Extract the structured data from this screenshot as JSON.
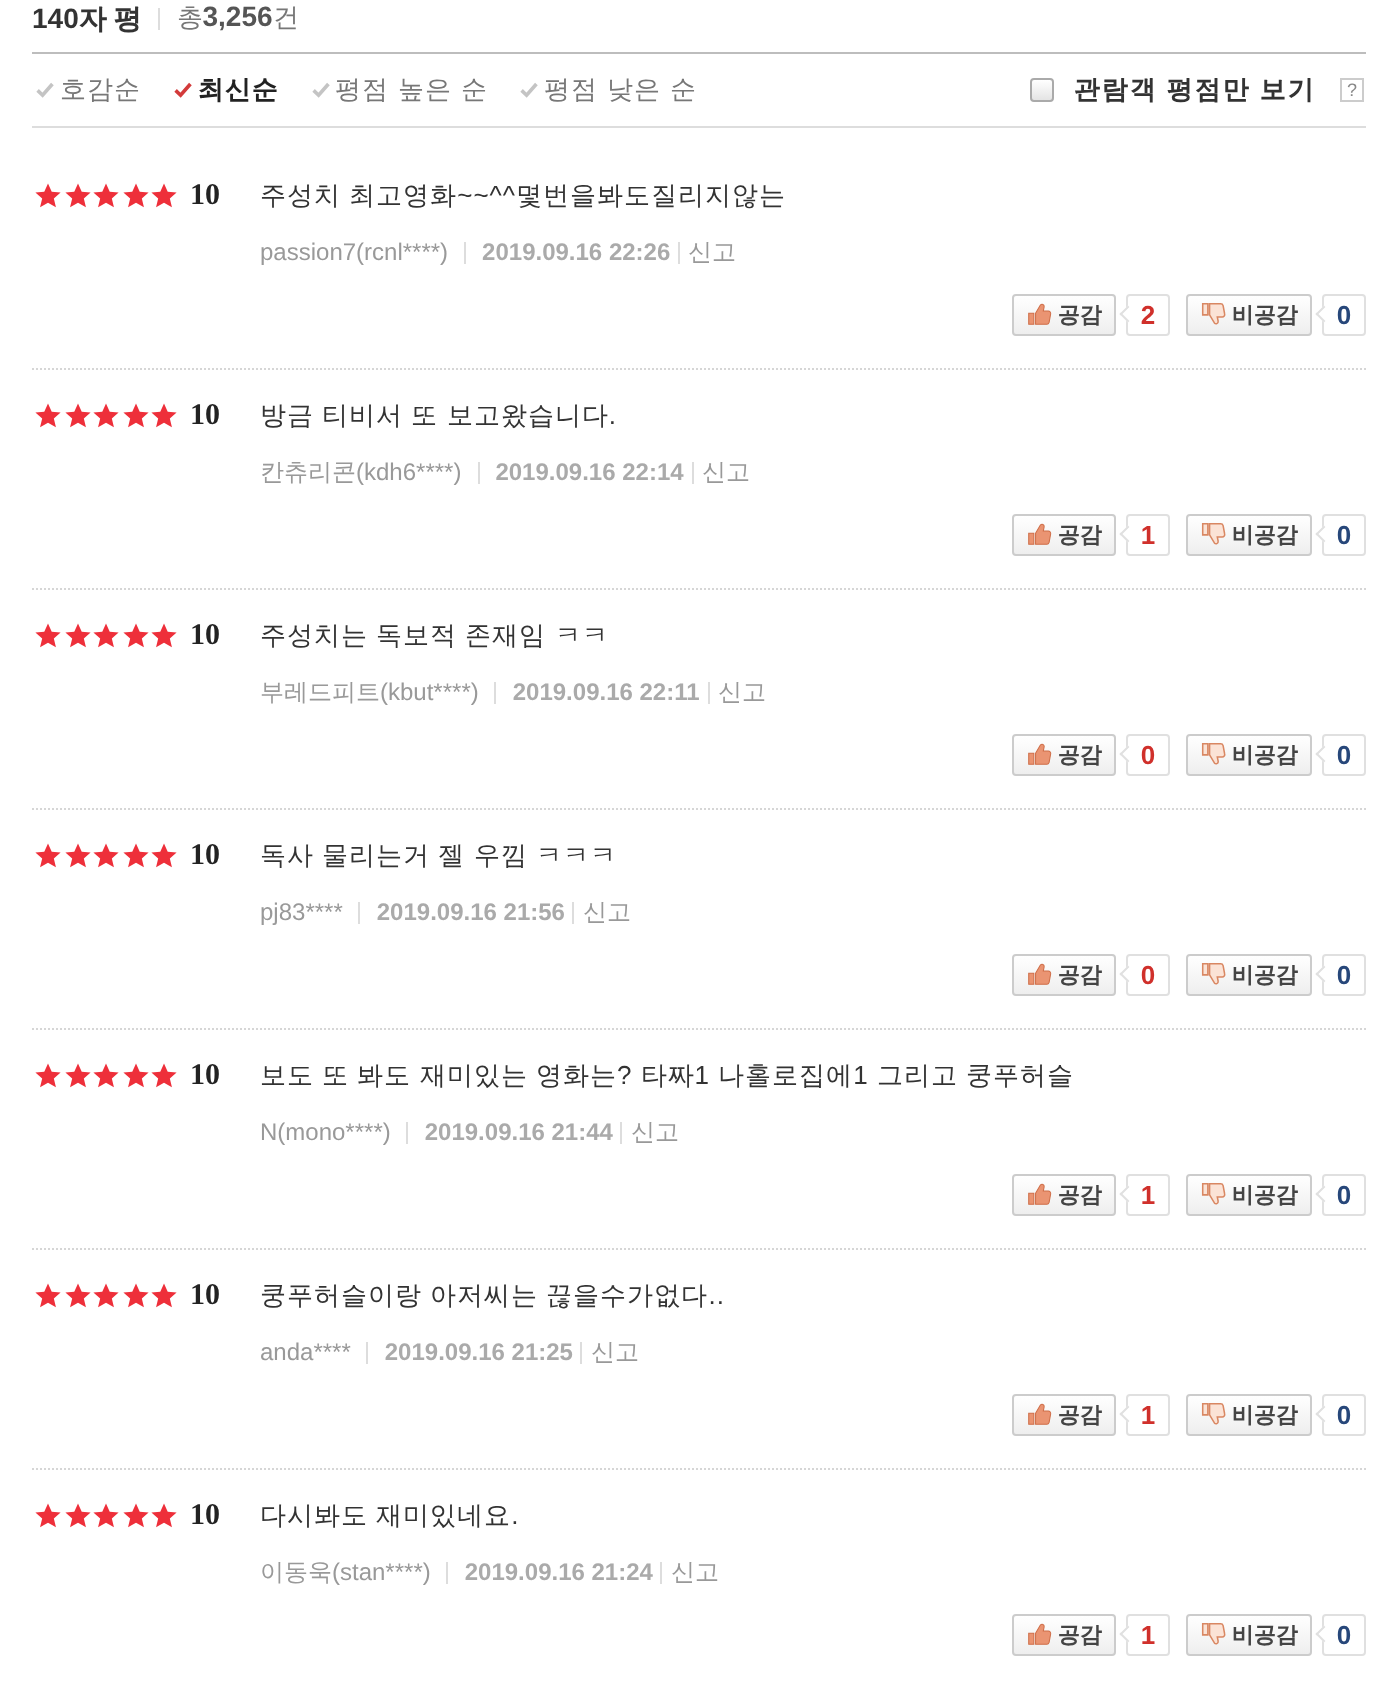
{
  "header": {
    "title": "140자 평",
    "total": "총**3,256**건"
  },
  "sort_options": [
    {
      "label": "호감순",
      "selected": false
    },
    {
      "label": "최신순",
      "selected": true
    },
    {
      "label": "평점 높은 순",
      "selected": false
    },
    {
      "label": "평점 낮은 순",
      "selected": false
    }
  ],
  "filter": {
    "label": "관람객 평점만 보기",
    "checked": false,
    "help": "?"
  },
  "reviews": [
    {
      "stars": 5,
      "score": "10",
      "text": "주성치 최고영화~~^^몇번을봐도질리지않는",
      "author": "passion7(rcnl****)",
      "date": "2019.09.16 22:26",
      "report": "신고",
      "like_label": "공감",
      "likes": "2",
      "dislike_label": "비공감",
      "dislikes": "0"
    },
    {
      "stars": 5,
      "score": "10",
      "text": "방금 티비서 또 보고왔습니다.",
      "author": "칸츄리콘(kdh6****)",
      "date": "2019.09.16 22:14",
      "report": "신고",
      "like_label": "공감",
      "likes": "1",
      "dislike_label": "비공감",
      "dislikes": "0"
    },
    {
      "stars": 5,
      "score": "10",
      "text": "주성치는 독보적 존재임 ㅋㅋ",
      "author": "부레드피트(kbut****)",
      "date": "2019.09.16 22:11",
      "report": "신고",
      "like_label": "공감",
      "likes": "0",
      "dislike_label": "비공감",
      "dislikes": "0"
    },
    {
      "stars": 5,
      "score": "10",
      "text": "독사 물리는거 젤 우낌 ㅋㅋㅋ",
      "author": "pj83****",
      "date": "2019.09.16 21:56",
      "report": "신고",
      "like_label": "공감",
      "likes": "0",
      "dislike_label": "비공감",
      "dislikes": "0"
    },
    {
      "stars": 5,
      "score": "10",
      "text": "보도 또 봐도 재미있는 영화는? 타짜1 나홀로집에1 그리고 쿵푸허슬",
      "author": "N(mono****)",
      "date": "2019.09.16 21:44",
      "report": "신고",
      "like_label": "공감",
      "likes": "1",
      "dislike_label": "비공감",
      "dislikes": "0"
    },
    {
      "stars": 5,
      "score": "10",
      "text": "쿵푸허슬이랑 아저씨는 끊을수가없다..",
      "author": "anda****",
      "date": "2019.09.16 21:25",
      "report": "신고",
      "like_label": "공감",
      "likes": "1",
      "dislike_label": "비공감",
      "dislikes": "0"
    },
    {
      "stars": 5,
      "score": "10",
      "text": "다시봐도 재미있네요.",
      "author": "이동욱(stan****)",
      "date": "2019.09.16 21:24",
      "report": "신고",
      "like_label": "공감",
      "likes": "1",
      "dislike_label": "비공감",
      "dislikes": "0"
    }
  ]
}
